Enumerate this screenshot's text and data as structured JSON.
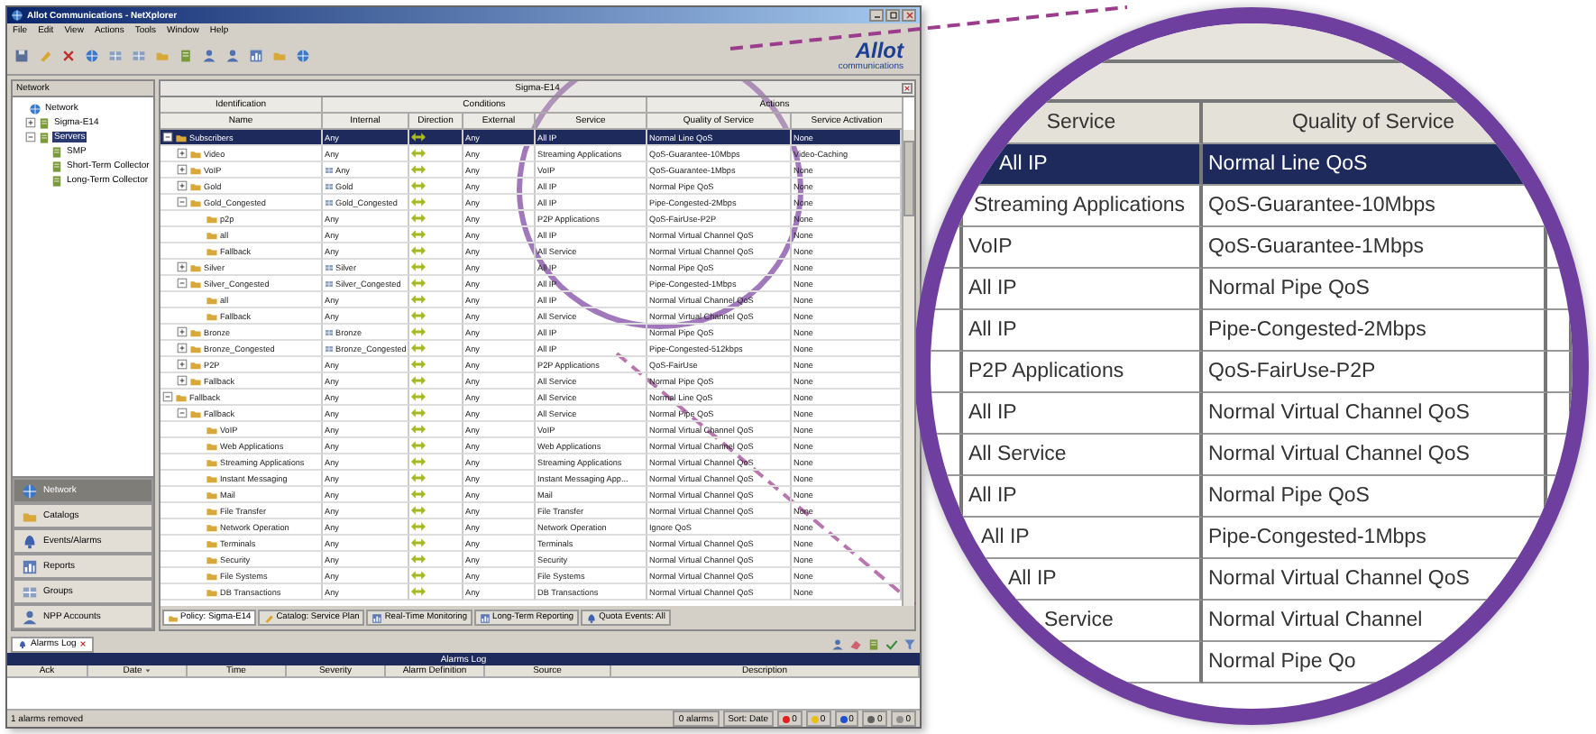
{
  "window": {
    "title": "Allot Communications - NetXplorer"
  },
  "menu": [
    "File",
    "Edit",
    "View",
    "Actions",
    "Tools",
    "Window",
    "Help"
  ],
  "logo": {
    "text": "Allot",
    "subtitle": "communications"
  },
  "network_panel": {
    "title": "Network",
    "tree": [
      {
        "label": "Network",
        "selected": false,
        "children": [
          {
            "label": "Sigma-E14",
            "expanded": false,
            "selected": false
          },
          {
            "label": "Servers",
            "expanded": true,
            "selected": true,
            "children": [
              {
                "label": "SMP",
                "selected": false
              },
              {
                "label": "Short-Term Collector",
                "selected": false
              },
              {
                "label": "Long-Term Collector",
                "selected": false
              }
            ]
          }
        ]
      }
    ]
  },
  "nav": [
    {
      "label": "Network",
      "selected": true
    },
    {
      "label": "Catalogs",
      "selected": false
    },
    {
      "label": "Events/Alarms",
      "selected": false
    },
    {
      "label": "Reports",
      "selected": false
    },
    {
      "label": "Groups",
      "selected": false
    },
    {
      "label": "NPP Accounts",
      "selected": false
    }
  ],
  "policy": {
    "title": "Sigma-E14",
    "groups": [
      {
        "label": "Identification",
        "columns": [
          "Name"
        ]
      },
      {
        "label": "Conditions",
        "columns": [
          "Internal",
          "Direction",
          "External",
          "Service"
        ]
      },
      {
        "label": "Actions",
        "columns": [
          "Quality of Service",
          "Service Activation"
        ]
      }
    ],
    "rows": [
      {
        "name": "Subscribers",
        "internal": "Any",
        "grouped": false,
        "external": "Any",
        "service": "All IP",
        "qos": "Normal Line QoS",
        "activation": "None",
        "selected": true,
        "expanded": true,
        "children": [
          {
            "name": "Video",
            "internal": "Any",
            "grouped": false,
            "external": "Any",
            "service": "Streaming Applications",
            "qos": "QoS-Guarantee-10Mbps",
            "activation": "Video-Caching",
            "selected": false,
            "expanded": false
          },
          {
            "name": "VoIP",
            "internal": "Any",
            "grouped": true,
            "external": "Any",
            "service": "VoIP",
            "qos": "QoS-Guarantee-1Mbps",
            "activation": "None",
            "selected": false,
            "expanded": false
          },
          {
            "name": "Gold",
            "internal": "Gold",
            "grouped": true,
            "external": "Any",
            "service": "All IP",
            "qos": "Normal Pipe QoS",
            "activation": "None",
            "selected": false,
            "expanded": false
          },
          {
            "name": "Gold_Congested",
            "internal": "Gold_Congested",
            "grouped": true,
            "external": "Any",
            "service": "All IP",
            "qos": "Pipe-Congested-2Mbps",
            "activation": "None",
            "selected": false,
            "expanded": true,
            "children": [
              {
                "name": "p2p",
                "internal": "Any",
                "grouped": false,
                "external": "Any",
                "service": "P2P Applications",
                "qos": "QoS-FairUse-P2P",
                "activation": "None",
                "selected": false
              },
              {
                "name": "all",
                "internal": "Any",
                "grouped": false,
                "external": "Any",
                "service": "All IP",
                "qos": "Normal Virtual Channel QoS",
                "activation": "None",
                "selected": false
              },
              {
                "name": "Fallback",
                "internal": "Any",
                "grouped": false,
                "external": "Any",
                "service": "All Service",
                "qos": "Normal Virtual Channel QoS",
                "activation": "None",
                "selected": false
              }
            ]
          },
          {
            "name": "Silver",
            "internal": "Silver",
            "grouped": true,
            "external": "Any",
            "service": "All IP",
            "qos": "Normal Pipe QoS",
            "activation": "None",
            "selected": false,
            "expanded": false
          },
          {
            "name": "Silver_Congested",
            "internal": "Silver_Congested",
            "grouped": true,
            "external": "Any",
            "service": "All IP",
            "qos": "Pipe-Congested-1Mbps",
            "activation": "None",
            "selected": false,
            "expanded": true,
            "children": [
              {
                "name": "all",
                "internal": "Any",
                "grouped": false,
                "external": "Any",
                "service": "All IP",
                "qos": "Normal Virtual Channel QoS",
                "activation": "None",
                "selected": false
              },
              {
                "name": "Fallback",
                "internal": "Any",
                "grouped": false,
                "external": "Any",
                "service": "All Service",
                "qos": "Normal Virtual Channel QoS",
                "activation": "None",
                "selected": false
              }
            ]
          },
          {
            "name": "Bronze",
            "internal": "Bronze",
            "grouped": true,
            "external": "Any",
            "service": "All IP",
            "qos": "Normal Pipe QoS",
            "activation": "None",
            "selected": false,
            "expanded": false
          },
          {
            "name": "Bronze_Congested",
            "internal": "Bronze_Congested",
            "grouped": true,
            "external": "Any",
            "service": "All IP",
            "qos": "Pipe-Congested-512kbps",
            "activation": "None",
            "selected": false,
            "expanded": false
          },
          {
            "name": "P2P",
            "internal": "Any",
            "grouped": false,
            "external": "Any",
            "service": "P2P Applications",
            "qos": "QoS-FairUse",
            "activation": "None",
            "selected": false,
            "expanded": false
          },
          {
            "name": "Fallback",
            "internal": "Any",
            "grouped": false,
            "external": "Any",
            "service": "All Service",
            "qos": "Normal Pipe QoS",
            "activation": "None",
            "selected": false,
            "expanded": false
          }
        ]
      },
      {
        "name": "Fallback",
        "internal": "Any",
        "grouped": false,
        "external": "Any",
        "service": "All Service",
        "qos": "Normal Line QoS",
        "activation": "None",
        "selected": false,
        "expanded": true,
        "children": [
          {
            "name": "Fallback",
            "internal": "Any",
            "grouped": false,
            "external": "Any",
            "service": "All Service",
            "qos": "Normal Pipe QoS",
            "activation": "None",
            "selected": false,
            "expanded": true,
            "children": [
              {
                "name": "VoIP",
                "internal": "Any",
                "grouped": false,
                "external": "Any",
                "service": "VoIP",
                "qos": "Normal Virtual Channel QoS",
                "activation": "None",
                "selected": false
              },
              {
                "name": "Web Applications",
                "internal": "Any",
                "grouped": false,
                "external": "Any",
                "service": "Web Applications",
                "qos": "Normal Virtual Channel QoS",
                "activation": "None",
                "selected": false
              },
              {
                "name": "Streaming Applications",
                "internal": "Any",
                "grouped": false,
                "external": "Any",
                "service": "Streaming Applications",
                "qos": "Normal Virtual Channel QoS",
                "activation": "None",
                "selected": false
              },
              {
                "name": "Instant Messaging",
                "internal": "Any",
                "grouped": false,
                "external": "Any",
                "service": "Instant Messaging App...",
                "qos": "Normal Virtual Channel QoS",
                "activation": "None",
                "selected": false
              },
              {
                "name": "Mail",
                "internal": "Any",
                "grouped": false,
                "external": "Any",
                "service": "Mail",
                "qos": "Normal Virtual Channel QoS",
                "activation": "None",
                "selected": false
              },
              {
                "name": "File Transfer",
                "internal": "Any",
                "grouped": false,
                "external": "Any",
                "service": "File Transfer",
                "qos": "Normal Virtual Channel QoS",
                "activation": "None",
                "selected": false
              },
              {
                "name": "Network Operation",
                "internal": "Any",
                "grouped": false,
                "external": "Any",
                "service": "Network Operation",
                "qos": "Ignore QoS",
                "activation": "None",
                "selected": false
              },
              {
                "name": "Terminals",
                "internal": "Any",
                "grouped": false,
                "external": "Any",
                "service": "Terminals",
                "qos": "Normal Virtual Channel QoS",
                "activation": "None",
                "selected": false
              },
              {
                "name": "Security",
                "internal": "Any",
                "grouped": false,
                "external": "Any",
                "service": "Security",
                "qos": "Normal Virtual Channel QoS",
                "activation": "None",
                "selected": false
              },
              {
                "name": "File Systems",
                "internal": "Any",
                "grouped": false,
                "external": "Any",
                "service": "File Systems",
                "qos": "Normal Virtual Channel QoS",
                "activation": "None",
                "selected": false
              },
              {
                "name": "DB Transactions",
                "internal": "Any",
                "grouped": false,
                "external": "Any",
                "service": "DB Transactions",
                "qos": "Normal Virtual Channel QoS",
                "activation": "None",
                "selected": false
              }
            ]
          }
        ]
      }
    ]
  },
  "tabs": [
    {
      "label": "Policy: Sigma-E14",
      "selected": true
    },
    {
      "label": "Catalog: Service Plan",
      "selected": false
    },
    {
      "label": "Real-Time Monitoring",
      "selected": false
    },
    {
      "label": "Long-Term Reporting",
      "selected": false
    },
    {
      "label": "Quota Events: All",
      "selected": false
    }
  ],
  "alarms": {
    "tab": "Alarms Log",
    "title": "Alarms Log",
    "columns": [
      "Ack",
      "Date",
      "Time",
      "Severity",
      "Alarm Definition",
      "Source",
      "Description"
    ],
    "status": "1 alarms removed",
    "count": "0 alarms",
    "sort": "Sort: Date",
    "severity_counts": [
      {
        "value": "0",
        "color": "#e02020"
      },
      {
        "value": "0",
        "color": "#e8c010"
      },
      {
        "value": "0",
        "color": "#2050d0"
      },
      {
        "value": "0",
        "color": "#606060"
      },
      {
        "value": "0",
        "color": "#909090"
      }
    ]
  },
  "magnifier": {
    "columns": [
      "Service",
      "Quality of Service"
    ],
    "rows": [
      {
        "service": "All IP",
        "qos": "Normal Line QoS",
        "selected": true
      },
      {
        "service": "Streaming Applications",
        "qos": "QoS-Guarantee-10Mbps",
        "selected": false
      },
      {
        "service": "VoIP",
        "qos": "QoS-Guarantee-1Mbps",
        "selected": false
      },
      {
        "service": "All IP",
        "qos": "Normal Pipe QoS",
        "selected": false
      },
      {
        "service": "All IP",
        "qos": "Pipe-Congested-2Mbps",
        "selected": false
      },
      {
        "service": "P2P Applications",
        "qos": "QoS-FairUse-P2P",
        "selected": false
      },
      {
        "service": "All IP",
        "qos": "Normal Virtual Channel QoS",
        "selected": false
      },
      {
        "service": "All Service",
        "qos": "Normal Virtual Channel QoS",
        "selected": false
      },
      {
        "service": "All IP",
        "qos": "Normal Pipe QoS",
        "selected": false
      },
      {
        "service": "All IP",
        "qos": "Pipe-Congested-1Mbps",
        "selected": false
      },
      {
        "service": "All IP",
        "qos": "Normal Virtual Channel QoS",
        "selected": false
      },
      {
        "service": "Service",
        "qos": "Normal Virtual Channel",
        "selected": false
      },
      {
        "service": "",
        "qos": "Normal Pipe Qo",
        "selected": false
      }
    ]
  }
}
